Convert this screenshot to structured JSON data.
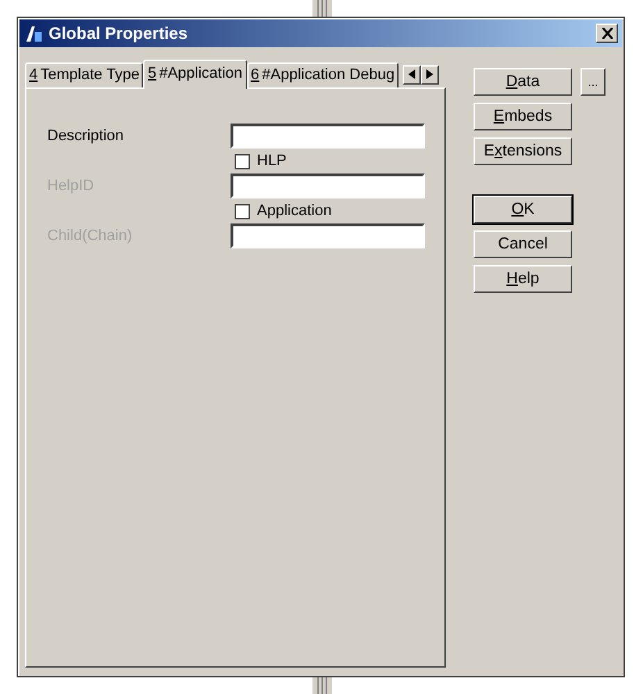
{
  "window": {
    "title": "Global Properties"
  },
  "tabs": [
    {
      "key": "4",
      "post": "Template Type",
      "selected": false
    },
    {
      "key": "5",
      "post": "#Application",
      "selected": true
    },
    {
      "key": "6",
      "post": "#Application Debug",
      "selected": false
    }
  ],
  "fields": [
    {
      "label": "Description",
      "disabled": false
    },
    {
      "kind": "checkbox",
      "label": "HLP",
      "checked": false
    },
    {
      "label": "HelpID",
      "disabled": true
    },
    {
      "kind": "checkbox",
      "label": "Application",
      "checked": false
    },
    {
      "label": "Child(Chain)",
      "disabled": true
    }
  ],
  "side_buttons": [
    {
      "key": "D",
      "post": "ata"
    },
    {
      "key": "E",
      "post": "mbeds"
    },
    {
      "pre": "E",
      "key": "x",
      "post": "tensions"
    }
  ],
  "more_button": "...",
  "dialog_buttons": [
    {
      "key": "O",
      "post": "K",
      "default": true
    },
    {
      "post": "Cancel",
      "default": false
    },
    {
      "key": "H",
      "post": "elp",
      "default": false
    }
  ]
}
